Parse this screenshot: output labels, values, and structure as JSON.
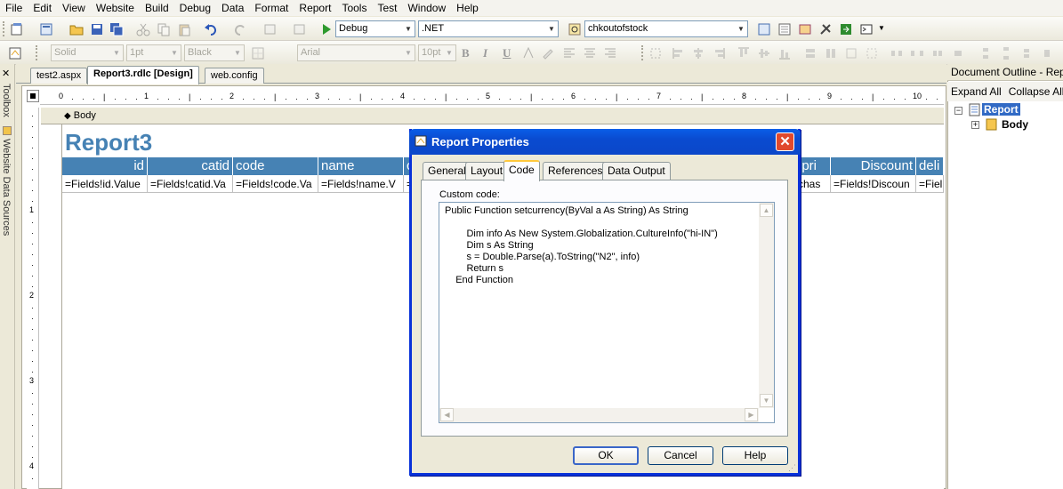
{
  "menu": [
    "File",
    "Edit",
    "View",
    "Website",
    "Build",
    "Debug",
    "Data",
    "Format",
    "Report",
    "Tools",
    "Test",
    "Window",
    "Help"
  ],
  "toolbar1": {
    "config": "Debug",
    "platform": ".NET",
    "find": "chkoutofstock"
  },
  "toolbar2": {
    "border_style": "Solid",
    "border_width": "1pt",
    "border_color": "Black",
    "font_family": "Arial",
    "font_size": "10pt",
    "bold": "B",
    "italic": "I",
    "underline": "U"
  },
  "side_tabs": [
    "Toolbox",
    "Website Data Sources"
  ],
  "doc_tabs": [
    {
      "label": "test2.aspx",
      "active": false
    },
    {
      "label": "Report3.rdlc [Design]",
      "active": true
    },
    {
      "label": "web.config",
      "active": false
    }
  ],
  "ruler": {
    "h_ticks": [
      "0",
      "1",
      "2",
      "3",
      "4",
      "5",
      "6",
      "7",
      "8",
      "9",
      "10"
    ],
    "v_ticks": [
      "1",
      "2",
      "3",
      "4"
    ]
  },
  "designer": {
    "body_label": "Body",
    "report_title": "Report3",
    "table": {
      "headers": [
        "id",
        "catid",
        "code",
        "name",
        "c",
        "epri",
        "Discount",
        "deli"
      ],
      "cells": [
        "=Fields!id.Value",
        "=Fields!catid.Va",
        "=Fields!code.Va",
        "=Fields!name.V",
        "=",
        "rchas",
        "=Fields!Discoun",
        "=Fiel"
      ]
    }
  },
  "outline": {
    "title": "Document Outline - Report",
    "expand_all": "Expand All",
    "collapse_all": "Collapse All",
    "root": "Report",
    "child": "Body"
  },
  "dialog": {
    "title": "Report Properties",
    "tabs": [
      "General",
      "Layout",
      "Code",
      "References",
      "Data Output"
    ],
    "active_tab": "Code",
    "custom_code_label": "Custom code:",
    "code": "Public Function setcurrency(ByVal a As String) As String\n\n        Dim info As New System.Globalization.CultureInfo(\"hi-IN\")\n        Dim s As String\n        s = Double.Parse(a).ToString(\"N2\", info)\n        Return s\n    End Function",
    "ok": "OK",
    "cancel": "Cancel",
    "help": "Help"
  },
  "colors": {
    "header_blue": "#4682b4",
    "xp_title_blue": "#0a5ee8"
  }
}
